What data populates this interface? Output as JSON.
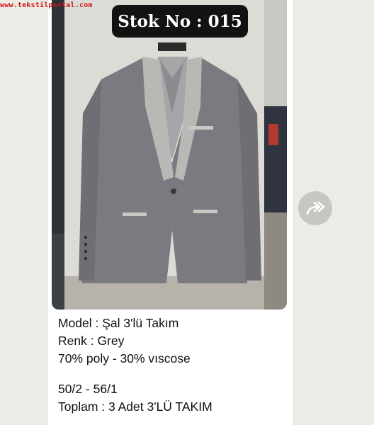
{
  "watermark": "www.tekstilportal.com",
  "message": {
    "image_badge": "Stok No : 015",
    "caption_lines": [
      "Model : Şal 3'lü Takım",
      "Renk : Grey",
      "70% poly - 30% vıscose",
      "50/2 - 56/1",
      "Toplam : 3 Adet 3'LÜ TAKIM"
    ],
    "forward_icon": "forward-arrow-icon"
  },
  "colors": {
    "chat_background": "#ecebe6",
    "bubble": "#ffffff",
    "badge": "#121212",
    "badge_text": "#ffffff",
    "watermark": "#d01818",
    "suit": "#7d7c82",
    "lapel": "#b9b8b4"
  }
}
